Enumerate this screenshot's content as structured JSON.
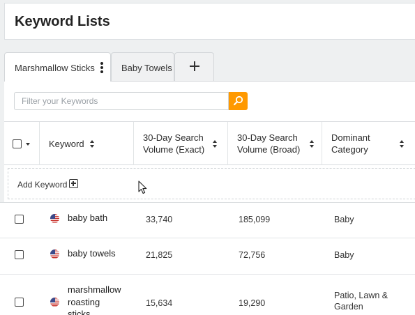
{
  "page": {
    "title": "Keyword Lists"
  },
  "tabs": [
    {
      "label": "Marshmallow Sticks",
      "active": true
    },
    {
      "label": "Baby Towels",
      "active": false
    },
    {
      "label": "+",
      "icon": "plus-icon"
    }
  ],
  "filter": {
    "placeholder": "Filter your Keywords",
    "value": "",
    "button_icon": "search-icon"
  },
  "table": {
    "headers": {
      "keyword": "Keyword",
      "exact_line1": "30-Day Search",
      "exact_line2": "Volume (Exact)",
      "broad_line1": "30-Day Search",
      "broad_line2": "Volume (Broad)",
      "category_line1": "Dominant",
      "category_line2": "Category"
    },
    "add_keyword_label": "Add Keyword",
    "rows": [
      {
        "flag": "us-flag-icon",
        "keyword_lines": [
          "baby bath"
        ],
        "exact": "33,740",
        "broad": "185,099",
        "category_lines": [
          "Baby"
        ]
      },
      {
        "flag": "us-flag-icon",
        "keyword_lines": [
          "baby towels"
        ],
        "exact": "21,825",
        "broad": "72,756",
        "category_lines": [
          "Baby"
        ]
      },
      {
        "flag": "us-flag-icon",
        "keyword_lines": [
          "marshmallow",
          "roasting",
          "sticks"
        ],
        "exact": "15,634",
        "broad": "19,290",
        "category_lines": [
          "Patio, Lawn &",
          "Garden"
        ]
      }
    ]
  },
  "colors": {
    "accent": "#ff9900",
    "background": "#eef0f1",
    "surface": "#ffffff",
    "border": "#d9dcdf"
  }
}
